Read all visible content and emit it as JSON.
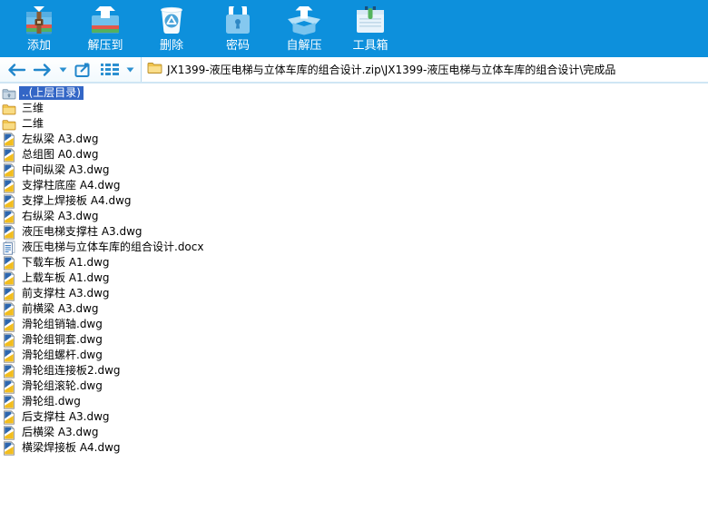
{
  "toolbar": {
    "items": [
      {
        "id": "add",
        "label": "添加",
        "icon": "add-archive-icon"
      },
      {
        "id": "extract-to",
        "label": "解压到",
        "icon": "extract-to-icon"
      },
      {
        "id": "delete",
        "label": "删除",
        "icon": "delete-icon"
      },
      {
        "id": "password",
        "label": "密码",
        "icon": "password-lock-icon"
      },
      {
        "id": "self-extract",
        "label": "自解压",
        "icon": "self-extract-icon"
      },
      {
        "id": "toolbox",
        "label": "工具箱",
        "icon": "toolbox-icon"
      }
    ]
  },
  "navbar": {
    "address": {
      "path": "JX1399-液压电梯与立体车库的组合设计.zip\\JX1399-液压电梯与立体车库的组合设计\\完成品"
    }
  },
  "file_list": {
    "items": [
      {
        "name": "..(上层目录)",
        "icon": "parent-folder-icon",
        "selected": true
      },
      {
        "name": "三维",
        "icon": "folder-icon",
        "selected": false
      },
      {
        "name": "二维",
        "icon": "folder-icon",
        "selected": false
      },
      {
        "name": "左纵梁 A3.dwg",
        "icon": "dwg-file-icon",
        "selected": false
      },
      {
        "name": "总组图 A0.dwg",
        "icon": "dwg-file-icon",
        "selected": false
      },
      {
        "name": "中间纵梁 A3.dwg",
        "icon": "dwg-file-icon",
        "selected": false
      },
      {
        "name": "支撑柱底座 A4.dwg",
        "icon": "dwg-file-icon",
        "selected": false
      },
      {
        "name": "支撑上焊接板 A4.dwg",
        "icon": "dwg-file-icon",
        "selected": false
      },
      {
        "name": "右纵梁 A3.dwg",
        "icon": "dwg-file-icon",
        "selected": false
      },
      {
        "name": "液压电梯支撑柱 A3.dwg",
        "icon": "dwg-file-icon",
        "selected": false
      },
      {
        "name": "液压电梯与立体车库的组合设计.docx",
        "icon": "docx-file-icon",
        "selected": false
      },
      {
        "name": "下载车板 A1.dwg",
        "icon": "dwg-file-icon",
        "selected": false
      },
      {
        "name": "上载车板 A1.dwg",
        "icon": "dwg-file-icon",
        "selected": false
      },
      {
        "name": "前支撑柱 A3.dwg",
        "icon": "dwg-file-icon",
        "selected": false
      },
      {
        "name": "前横梁 A3.dwg",
        "icon": "dwg-file-icon",
        "selected": false
      },
      {
        "name": "滑轮组销轴.dwg",
        "icon": "dwg-file-icon",
        "selected": false
      },
      {
        "name": "滑轮组铜套.dwg",
        "icon": "dwg-file-icon",
        "selected": false
      },
      {
        "name": "滑轮组螺杆.dwg",
        "icon": "dwg-file-icon",
        "selected": false
      },
      {
        "name": "滑轮组连接板2.dwg",
        "icon": "dwg-file-icon",
        "selected": false
      },
      {
        "name": "滑轮组滚轮.dwg",
        "icon": "dwg-file-icon",
        "selected": false
      },
      {
        "name": "滑轮组.dwg",
        "icon": "dwg-file-icon",
        "selected": false
      },
      {
        "name": "后支撑柱 A3.dwg",
        "icon": "dwg-file-icon",
        "selected": false
      },
      {
        "name": "后横梁 A3.dwg",
        "icon": "dwg-file-icon",
        "selected": false
      },
      {
        "name": "横梁焊接板 A4.dwg",
        "icon": "dwg-file-icon",
        "selected": false
      }
    ]
  },
  "colors": {
    "toolbar_bg": "#0d90dc",
    "toolbar_label": "#ffffff",
    "selection_bg": "#3366c6",
    "selection_text": "#ffffff",
    "nav_icon": "#2186cb",
    "list_text": "#000000",
    "folder_yellow": "#f0c44e"
  }
}
